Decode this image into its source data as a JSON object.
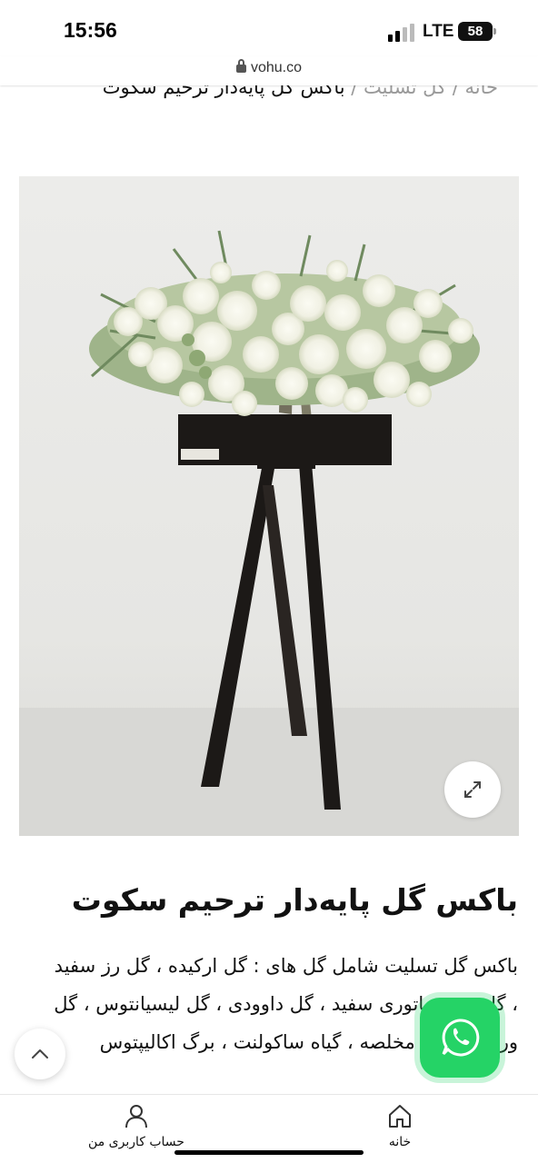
{
  "status_bar": {
    "time": "15:56",
    "network": "LTE",
    "battery": "58"
  },
  "browser": {
    "url": "vohu.co"
  },
  "breadcrumb": {
    "home": "خانه",
    "separator": " / ",
    "category": "گل تسلیت",
    "current": "باکس گل پایه‌دار ترحیم سکوت"
  },
  "product": {
    "title": "باکس گل پایه‌دار ترحیم سکوت",
    "description": "باکس گل تسلیت شامل گل های : گل ارکیده ، گل رز سفید ، گل رز مینیاتوری سفید ، گل داوودی ، گل لیسیانتوس ، گل ورونیکا ، گل مخلصه ، گیاه ساکولنت ، برگ اکالیپتوس"
  },
  "nav": {
    "account_label": "حساب کاربری من",
    "home_label": "خانه"
  },
  "icons": {
    "zoom": "expand-icon",
    "scroll_top": "chevron-up-icon",
    "whatsapp": "whatsapp-icon",
    "account": "user-icon",
    "home": "home-icon"
  },
  "colors": {
    "whatsapp": "#25d366",
    "stand": "#1c1917",
    "background": "#ffffff"
  }
}
